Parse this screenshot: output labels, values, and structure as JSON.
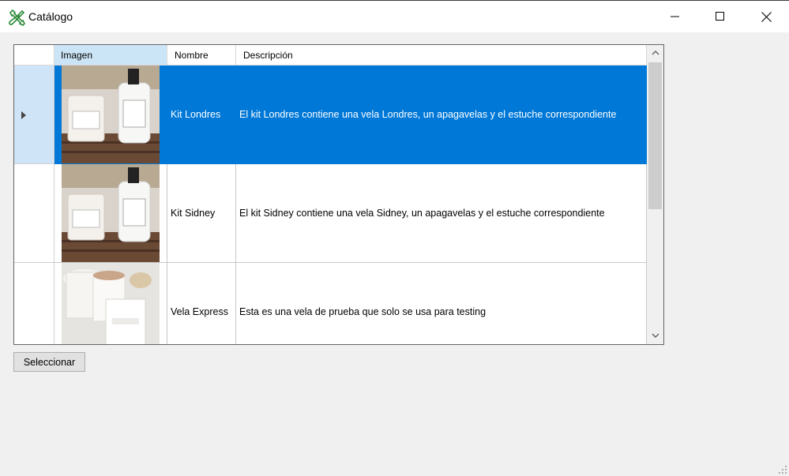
{
  "window": {
    "title": "Catálogo",
    "app_icon": "tools-icon",
    "controls": [
      "minimize-icon",
      "maximize-icon",
      "close-icon"
    ]
  },
  "grid": {
    "columns": [
      "Imagen",
      "Nombre",
      "Descripción"
    ],
    "active_column": "Imagen",
    "selected_row": 0,
    "rows": [
      {
        "image": "candle-kit-photo",
        "nombre": "Kit Londres",
        "descripcion": "El kit Londres contiene una vela Londres, un apagavelas y el estuche correspondiente"
      },
      {
        "image": "candle-kit-photo",
        "nombre": "Kit Sidney",
        "descripcion": "El kit Sidney contiene una vela Sidney, un apagavelas y el estuche correspondiente"
      },
      {
        "image": "candles-photo",
        "nombre": "Vela Express",
        "descripcion": "Esta es una vela de prueba que solo se usa para testing"
      }
    ]
  },
  "buttons": {
    "select_label": "Seleccionar"
  },
  "colors": {
    "selection": "#0078d7",
    "header_active": "#cce5f6",
    "window_bg": "#f0f0f0"
  }
}
